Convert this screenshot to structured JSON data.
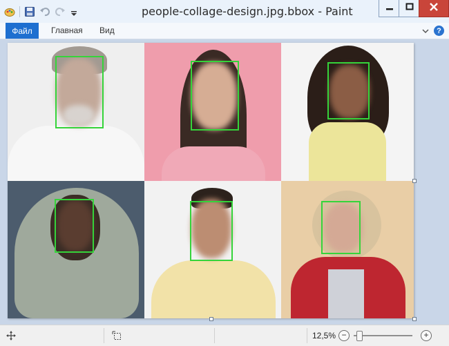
{
  "window": {
    "title": "people-collage-design.jpg.bbox - Paint"
  },
  "ribbon": {
    "tabs": [
      "Файл",
      "Главная",
      "Вид"
    ]
  },
  "status": {
    "zoom": "12,5%",
    "zoom_out_label": "−",
    "zoom_in_label": "+",
    "zoom_level": 0.05
  },
  "help_label": "?",
  "colors": {
    "titlebar": "#eaf2fb",
    "file_tab": "#1e6fd0",
    "canvas_bg": "#c9d6e8",
    "bbox": "#35d43a",
    "close_button": "#c9453a"
  },
  "icons": [
    "paint-app-icon",
    "save-icon",
    "undo-icon",
    "redo-icon",
    "customize-qat-icon",
    "minimize-icon",
    "maximize-icon",
    "close-icon",
    "ribbon-collapse-icon",
    "help-icon",
    "cursor-position-icon",
    "selection-size-icon",
    "zoom-out-icon",
    "zoom-in-icon"
  ]
}
